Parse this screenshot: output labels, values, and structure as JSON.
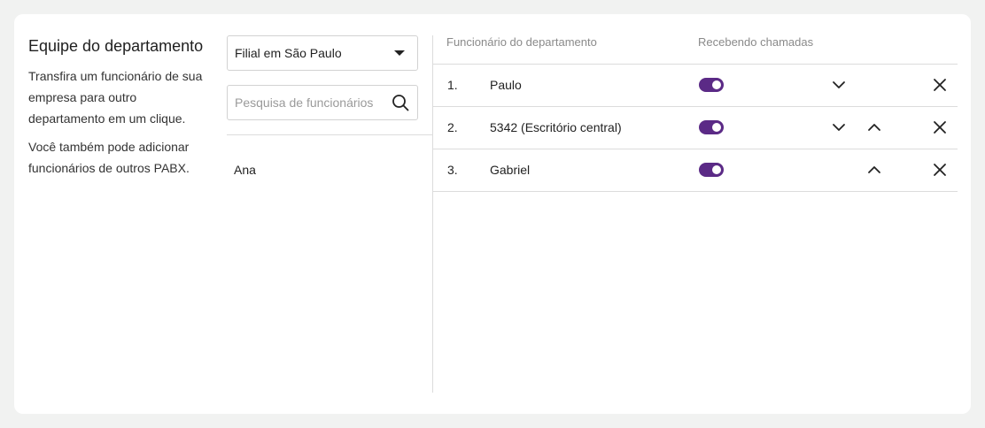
{
  "info": {
    "title": "Equipe do departamento",
    "paragraph1": "Transfira um funcionário de sua empresa para outro departamento em um clique.",
    "paragraph2": "Você também pode adicionar funcionários de outros PABX."
  },
  "branch_select": {
    "value": "Filial em São Paulo",
    "icon": "caret-down-icon"
  },
  "search": {
    "placeholder": "Pesquisa de funcionários",
    "value": "",
    "icon": "search-icon"
  },
  "available_employees": [
    "Ana"
  ],
  "table": {
    "headers": {
      "name": "Funcionário do departamento",
      "receiving": "Recebendo chamadas"
    },
    "rows": [
      {
        "num": "1.",
        "name": "Paulo",
        "receiving": true,
        "can_move_down": true,
        "can_move_up": false
      },
      {
        "num": "2.",
        "name": "5342 (Escritório central)",
        "receiving": true,
        "can_move_down": true,
        "can_move_up": true
      },
      {
        "num": "3.",
        "name": "Gabriel",
        "receiving": true,
        "can_move_down": false,
        "can_move_up": true
      }
    ]
  },
  "colors": {
    "background": "#f1f2f1",
    "card": "#ffffff",
    "toggle_on": "#5b2a86",
    "divider": "#dcdcdc",
    "header_text": "#8a8a8a"
  }
}
